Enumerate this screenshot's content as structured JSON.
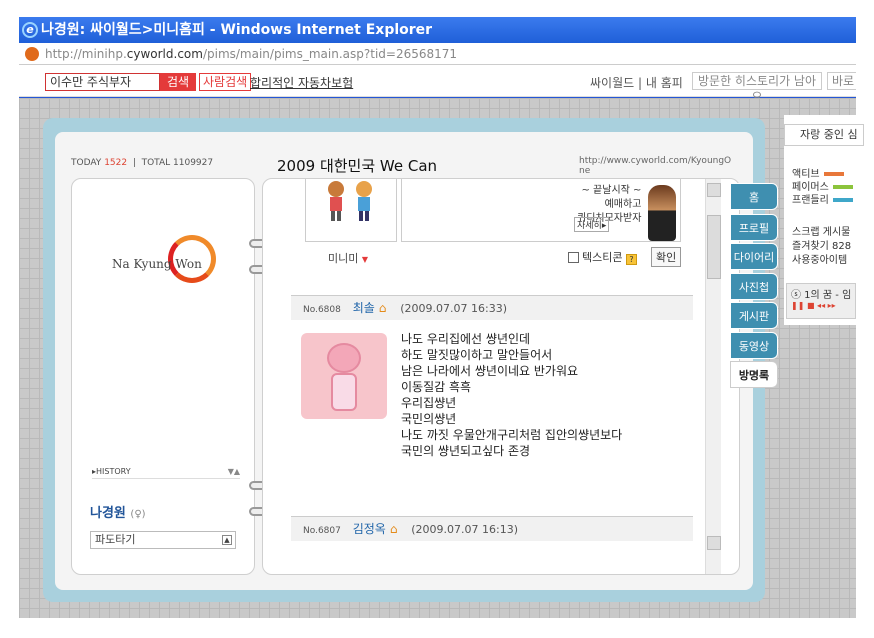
{
  "window": {
    "title": "나경원: 싸이월드>미니홈피 - Windows Internet Explorer",
    "url_prefix": "http://minihp.",
    "url_domain": "cyworld.com",
    "url_path": "/pims/main/pims_main.asp?tid=26568171"
  },
  "nav": {
    "search_value": "이수만 주식부자",
    "search_label": "검색",
    "people_search_label": "사람검색",
    "ad_link": "합리적인 자동차보험",
    "cyworld_link": "싸이월드",
    "sep": "|",
    "myhome_link": "내 홈피",
    "history_placeholder": "방문한 히스토리가 남아요",
    "more_label": "바로"
  },
  "header": {
    "today_label": "TODAY",
    "today_count": "1522",
    "total_label": "TOTAL",
    "total_count": "1109927",
    "title": "2009 대한민국 We Can",
    "url": "http://www.cyworld.com/KyoungOne"
  },
  "left": {
    "logo_text": "Na Kyung Won",
    "history_label": "HISTORY",
    "owner_name": "나경원",
    "owner_gender": "(♀)",
    "mood": "파도타기"
  },
  "right": {
    "minimi_label": "미니미",
    "ad_text": "~ 끝날시작 ~\n예매하고\n퀴디치모자받자",
    "ad_button": "자세히▸",
    "emoticon_label": "텍스티콘",
    "confirm_label": "확인",
    "entries": [
      {
        "no_label": "No.",
        "no": "6808",
        "name": "최솔",
        "date": "(2009.07.07 16:33)",
        "lines": [
          "나도 우리집에선 썅년인데",
          "하도 말짓많이하고 말안들어서",
          "남은 나라에서 썅년이네요 반가워요",
          "이동질감 흑흑",
          "우리집썅년",
          "국민의썅년",
          "나도 까짓 우물안개구리처럼 집안의썅년보다",
          "국민의 썅년되고싶다 존경"
        ]
      },
      {
        "no_label": "No.",
        "no": "6807",
        "name": "김정옥",
        "date": "(2009.07.07 16:13)"
      }
    ]
  },
  "tabs": [
    "홈",
    "프로필",
    "다이어리",
    "사진첩",
    "게시판",
    "동영상",
    "방명록"
  ],
  "active_tab": "방명록",
  "side": {
    "popular_label": "자랑 중인 심",
    "items": [
      "액티브",
      "페이머스",
      "프랜들리"
    ],
    "bar_colors": [
      "#e8773a",
      "#8cc43c",
      "#3fa7c9"
    ],
    "scrap_label": "스크랩 게시물",
    "fav_label": "즐겨찾기 828",
    "use_label": "사용중아이템",
    "player_text": "ⓢ 1의 꿈 - 임"
  }
}
